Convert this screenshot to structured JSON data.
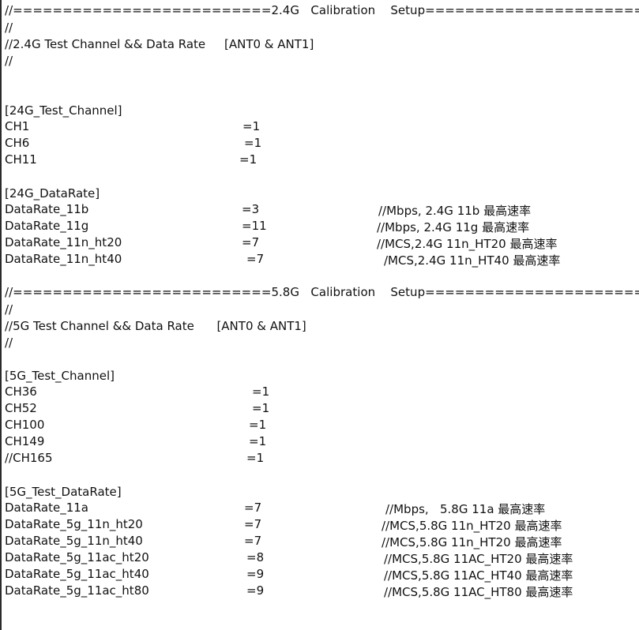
{
  "section24": {
    "header": "//==========================2.4G   Calibration    Setup======================",
    "blank1": "//",
    "title": "//2.4G Test Channel && Data Rate     [ANT0 & ANT1]",
    "blank2": "//"
  },
  "channel24": {
    "heading": "[24G_Test_Channel]",
    "rows": [
      {
        "key": "CH1",
        "val": "=1"
      },
      {
        "key": "CH6",
        "val": "=1"
      },
      {
        "key": "CH11",
        "val": "=1"
      }
    ]
  },
  "rate24": {
    "heading": "[24G_DataRate]",
    "rows": [
      {
        "key": "DataRate_11b",
        "val": "=3",
        "comment": "//Mbps, 2.4G 11b 最高速率"
      },
      {
        "key": "DataRate_11g",
        "val": "=11",
        "comment": "//Mbps, 2.4G 11g 最高速率"
      },
      {
        "key": "DataRate_11n_ht20",
        "val": "=7",
        "comment": "//MCS,2.4G 11n_HT20 最高速率"
      },
      {
        "key": "DataRate_11n_ht40",
        "val": "=7",
        "comment": "/MCS,2.4G 11n_HT40 最高速率"
      }
    ]
  },
  "section58": {
    "header": "//==========================5.8G   Calibration    Setup======================",
    "blank1": "//",
    "title": "//5G Test Channel && Data Rate      [ANT0 & ANT1]",
    "blank2": "//"
  },
  "channel5": {
    "heading": "[5G_Test_Channel]",
    "rows": [
      {
        "key": "CH36",
        "val": "=1"
      },
      {
        "key": "CH52",
        "val": "=1"
      },
      {
        "key": "CH100",
        "val": "=1"
      },
      {
        "key": "CH149",
        "val": "=1"
      },
      {
        "key": "//CH165",
        "val": "=1"
      }
    ]
  },
  "rate5": {
    "heading": "[5G_Test_DataRate]",
    "rows": [
      {
        "key": "DataRate_11a",
        "val": "=7",
        "comment": "//Mbps,   5.8G 11a 最高速率"
      },
      {
        "key": "DataRate_5g_11n_ht20",
        "val": "=7",
        "comment": "//MCS,5.8G 11n_HT20 最高速率"
      },
      {
        "key": "DataRate_5g_11n_ht40",
        "val": "=7",
        "comment": "//MCS,5.8G 11n_HT20 最高速率"
      },
      {
        "key": "DataRate_5g_11ac_ht20",
        "val": "=8",
        "comment": "//MCS,5.8G 11AC_HT20 最高速率"
      },
      {
        "key": "DataRate_5g_11ac_ht40",
        "val": "=9",
        "comment": "//MCS,5.8G 11AC_HT40 最高速率"
      },
      {
        "key": "DataRate_5g_11ac_ht80",
        "val": "=9",
        "comment": "//MCS,5.8G 11AC_HT80 最高速率"
      }
    ]
  }
}
